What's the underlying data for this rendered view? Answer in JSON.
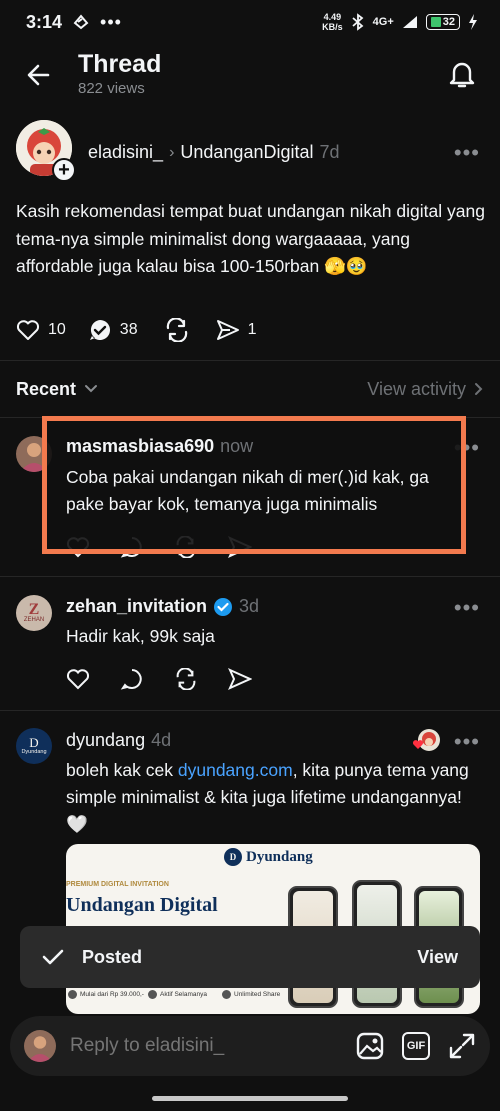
{
  "status_bar": {
    "time": "3:14",
    "net_speed": "4.49",
    "net_unit": "KB/s",
    "signal": "4G+",
    "battery": "32"
  },
  "header": {
    "title": "Thread",
    "views": "822 views"
  },
  "post": {
    "username": "eladisini_",
    "separator": "›",
    "community": "UndanganDigital",
    "time": "7d",
    "text": "Kasih rekomendasi tempat buat undangan nikah digital yang tema-nya simple minimalist dong wargaaaaa, yang affordable juga kalau bisa 100-150rban 🫣🥹",
    "likes": "10",
    "replies": "38",
    "shares": "1"
  },
  "recent": {
    "label": "Recent",
    "view_activity": "View activity"
  },
  "replies": [
    {
      "username": "masmasbiasa690",
      "time": "now",
      "text": "Coba pakai undangan nikah di mer(.)id kak, ga pake bayar kok, temanya juga minimalis"
    },
    {
      "username": "zehan_invitation",
      "time": "3d",
      "text": "Hadir kak, 99k saja",
      "avatar_text": "ZEHAN"
    },
    {
      "username": "dyundang",
      "time": "4d",
      "text_before": "boleh kak cek ",
      "link": "dyundang.com",
      "text_after": ", kita punya tema yang simple minimalist & kita juga lifetime undangannya!🤍",
      "avatar_text": "Dyundang"
    }
  ],
  "preview": {
    "logo": "Dyundang",
    "tagline": "PREMIUM DIGITAL INVITATION",
    "heading": "Undangan Digital",
    "features": [
      "Mulai dari Rp 39.000,-",
      "Aktif Selamanya",
      "Unlimited Share"
    ]
  },
  "toast": {
    "text": "Posted",
    "action": "View"
  },
  "reply_bar": {
    "placeholder": "Reply to eladisini_",
    "gif_label": "GIF"
  }
}
